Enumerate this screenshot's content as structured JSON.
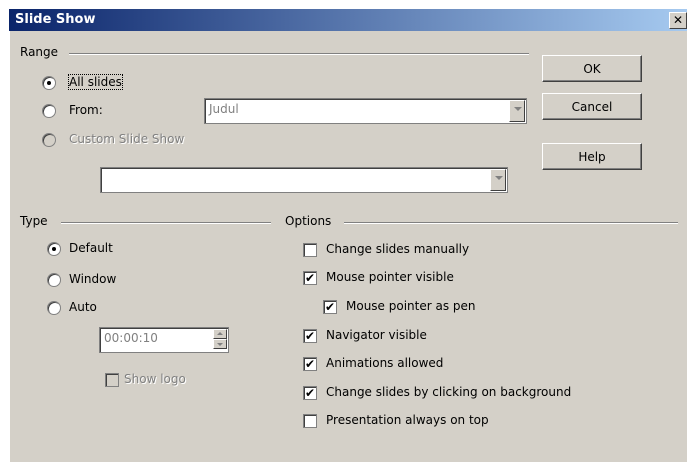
{
  "window": {
    "title": "Slide Show",
    "close_glyph": "✕"
  },
  "range": {
    "group_title": "Range",
    "all_slides": {
      "label": "All slides",
      "checked": true
    },
    "from": {
      "label": "From:",
      "checked": false,
      "value": "Judul"
    },
    "custom": {
      "label": "Custom Slide Show",
      "checked": false,
      "disabled": true,
      "value": ""
    }
  },
  "buttons": {
    "ok": "OK",
    "cancel": "Cancel",
    "help": "Help"
  },
  "type": {
    "group_title": "Type",
    "default": {
      "label": "Default",
      "checked": true
    },
    "window": {
      "label": "Window",
      "checked": false
    },
    "auto": {
      "label": "Auto",
      "checked": false
    },
    "pause": {
      "value": "00:00:10"
    },
    "show_logo": {
      "label": "Show logo",
      "checked": false,
      "disabled": true
    }
  },
  "options": {
    "group_title": "Options",
    "items": [
      {
        "label": "Change slides manually",
        "checked": false
      },
      {
        "label": "Mouse pointer visible",
        "checked": true
      },
      {
        "label": "Mouse pointer as pen",
        "checked": true
      },
      {
        "label": "Navigator visible",
        "checked": true
      },
      {
        "label": "Animations allowed",
        "checked": true
      },
      {
        "label": "Change slides by clicking on background",
        "checked": true
      },
      {
        "label": "Presentation always on top",
        "checked": false
      }
    ],
    "check_glyph": "✔"
  },
  "icons": {
    "combo_arrow": "chevron-down-icon",
    "spin": "spin-arrows-icon"
  }
}
